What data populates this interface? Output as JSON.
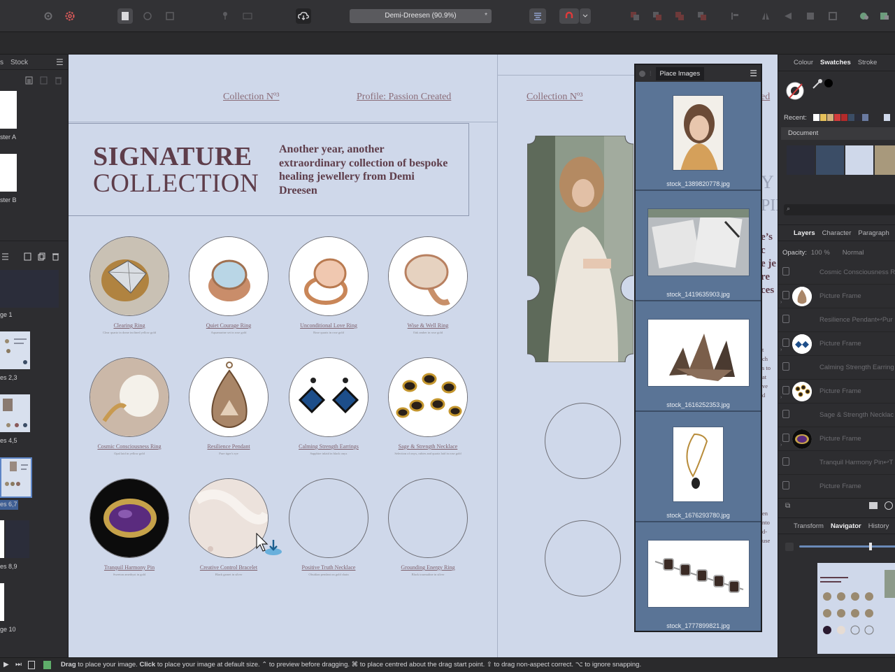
{
  "toolbar": {
    "document_title": "Demi-Dreesen (90.9%)",
    "modified_mark": "*"
  },
  "left_panel": {
    "tab_label": "Stock",
    "tab_partial": "s",
    "masters": [
      "ster A",
      "ster B"
    ],
    "pages": [
      "ge 1",
      "es 2,3",
      "es 4,5",
      "es 6,7",
      "es 8,9",
      "ge 10"
    ]
  },
  "page": {
    "header_left": "Collection Nº³",
    "header_mid": "Profile: Passion Created",
    "header_right": "Collection Nº³",
    "header_right_partial": "ed",
    "title_line1": "SIGNATURE",
    "title_line2": "COLLECTION",
    "intro": "Another year, another extraordinary collection of bespoke healing jewellery from Demi Dreesen",
    "right_fragments": [
      "Y",
      "PIE",
      "e’s c",
      "e je",
      "re",
      "ces",
      "t",
      "ch",
      "s to",
      "at",
      "ve",
      "d",
      "en",
      "nto",
      "d-",
      "use"
    ],
    "products": [
      {
        "name": "Clearing Ring",
        "desc": "Clear quartz in dome inclined yellow gold"
      },
      {
        "name": "Quiet Courage Ring",
        "desc": "Aquamarine set in rose gold"
      },
      {
        "name": "Unconditional Love Ring",
        "desc": "Rose quartz in rose gold"
      },
      {
        "name": "Wise & Well Ring",
        "desc": "Oak amber in rose gold"
      },
      {
        "name": "Cosmic Consciousness Ring",
        "desc": "Opal laid in yellow gold"
      },
      {
        "name": "Resilience Pendant",
        "desc": "Pure tiger's eye"
      },
      {
        "name": "Calming Strength Earrings",
        "desc": "Sapphire inlaid in black onyx"
      },
      {
        "name": "Sage & Strength Necklace",
        "desc": "Selection of onyx, rubies and quartz laid in rose gold"
      },
      {
        "name": "Tranquil Harmony Pin",
        "desc": "Sweeton amethyst in gold"
      },
      {
        "name": "Creative Control Bracelet",
        "desc": "Black garnet in silver"
      },
      {
        "name": "Positive Truth Necklace",
        "desc": "Obsidian pendant on gold chain"
      },
      {
        "name": "Grounding Energy Ring",
        "desc": "Black tourmaline in silver"
      }
    ]
  },
  "place_images": {
    "title": "Place Images",
    "files": [
      "stock_1389820778.jpg",
      "stock_1419635903.jpg",
      "stock_1616252353.jpg",
      "stock_1676293780.jpg",
      "stock_1777899821.jpg"
    ]
  },
  "right_panel": {
    "tabs_top": [
      "Colour",
      "Swatches",
      "Stroke"
    ],
    "recent_label": "Recent:",
    "palette_label": "Document",
    "tabs_mid": [
      "Layers",
      "Character",
      "Paragraph"
    ],
    "opacity_label": "Opacity:",
    "opacity_value": "100 %",
    "blend_mode": "Normal",
    "layers": [
      {
        "label": "Cosmic Consciousness R",
        "kind": "text"
      },
      {
        "label": "Picture Frame",
        "kind": "frame"
      },
      {
        "label": "Resilience Pendant↩Pur",
        "kind": "text"
      },
      {
        "label": "Picture Frame",
        "kind": "frame"
      },
      {
        "label": "Calming Strength Earring",
        "kind": "text"
      },
      {
        "label": "Picture Frame",
        "kind": "frame"
      },
      {
        "label": "Sage & Strength Necklac",
        "kind": "text"
      },
      {
        "label": "Picture Frame",
        "kind": "frame"
      },
      {
        "label": "Tranquil Harmony Pin↩T",
        "kind": "text"
      },
      {
        "label": "Picture Frame",
        "kind": "frame"
      }
    ],
    "tabs_bottom": [
      "Transform",
      "Navigator",
      "History"
    ]
  },
  "status": {
    "s1": "Drag",
    "s2": " to place your image. ",
    "s3": "Click",
    "s4": " to place your image at default size. ⌃ to preview before dragging. ⌘ to place centred about the drag start point. ⇧ to drag non-aspect correct. ⌥ to ignore snapping."
  },
  "colors": {
    "canvas": "#cfd8ea",
    "panel": "#2d2d30",
    "place_bg": "#5a7496",
    "accent_red": "#d23b3b"
  }
}
